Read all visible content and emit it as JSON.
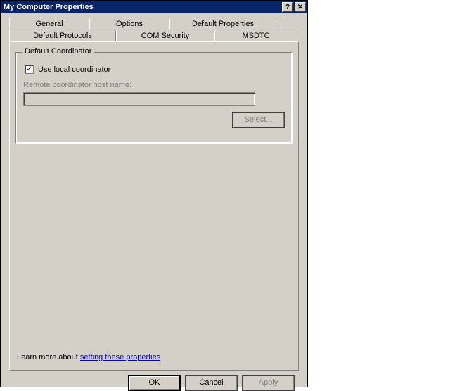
{
  "window": {
    "title": "My Computer Properties"
  },
  "tabs": {
    "row1": [
      {
        "label": "General"
      },
      {
        "label": "Options"
      },
      {
        "label": "Default Properties"
      }
    ],
    "row2": [
      {
        "label": "Default Protocols"
      },
      {
        "label": "COM Security"
      },
      {
        "label": "MSDTC"
      }
    ]
  },
  "group": {
    "title": "Default Coordinator",
    "checkbox_label": "Use local coordinator",
    "checkbox_checked": true,
    "remote_label": "Remote coordinator host name:",
    "remote_value": "",
    "select_button": "Select..."
  },
  "learn": {
    "prefix": "Learn more about ",
    "link_text": "setting these properties",
    "suffix": "."
  },
  "buttons": {
    "ok": "OK",
    "cancel": "Cancel",
    "apply": "Apply"
  }
}
